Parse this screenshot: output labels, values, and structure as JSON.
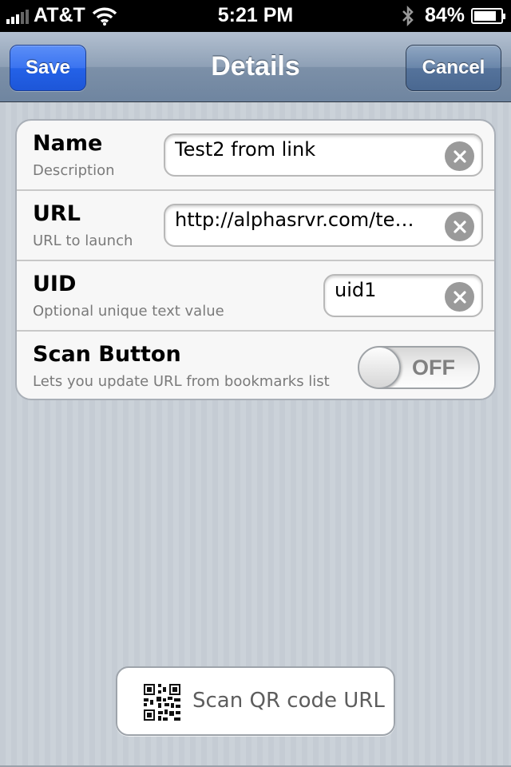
{
  "status_bar": {
    "carrier": "AT&T",
    "time": "5:21 PM",
    "battery_percent": "84%",
    "battery_level": 0.84,
    "icons": [
      "signal-icon",
      "wifi-icon",
      "bluetooth-icon",
      "battery-icon"
    ]
  },
  "nav": {
    "title": "Details",
    "save_label": "Save",
    "cancel_label": "Cancel"
  },
  "form": {
    "rows": [
      {
        "label": "Name",
        "sublabel": "Description",
        "value": "Test2 from link"
      },
      {
        "label": "URL",
        "sublabel": "URL to launch",
        "value": "http://alphasrvr.com/te…"
      },
      {
        "label": "UID",
        "sublabel": "Optional unique text value",
        "value": "uid1"
      },
      {
        "label": "Scan Button",
        "sublabel": "Lets you update URL from bookmarks list",
        "toggle": "OFF"
      }
    ]
  },
  "scan_button": {
    "label": "Scan QR code URL",
    "icon": "qr-code-icon"
  },
  "colors": {
    "save_button": "#2462e8",
    "nav_bar": "#7c90a8",
    "background": "#c5ccd4"
  }
}
